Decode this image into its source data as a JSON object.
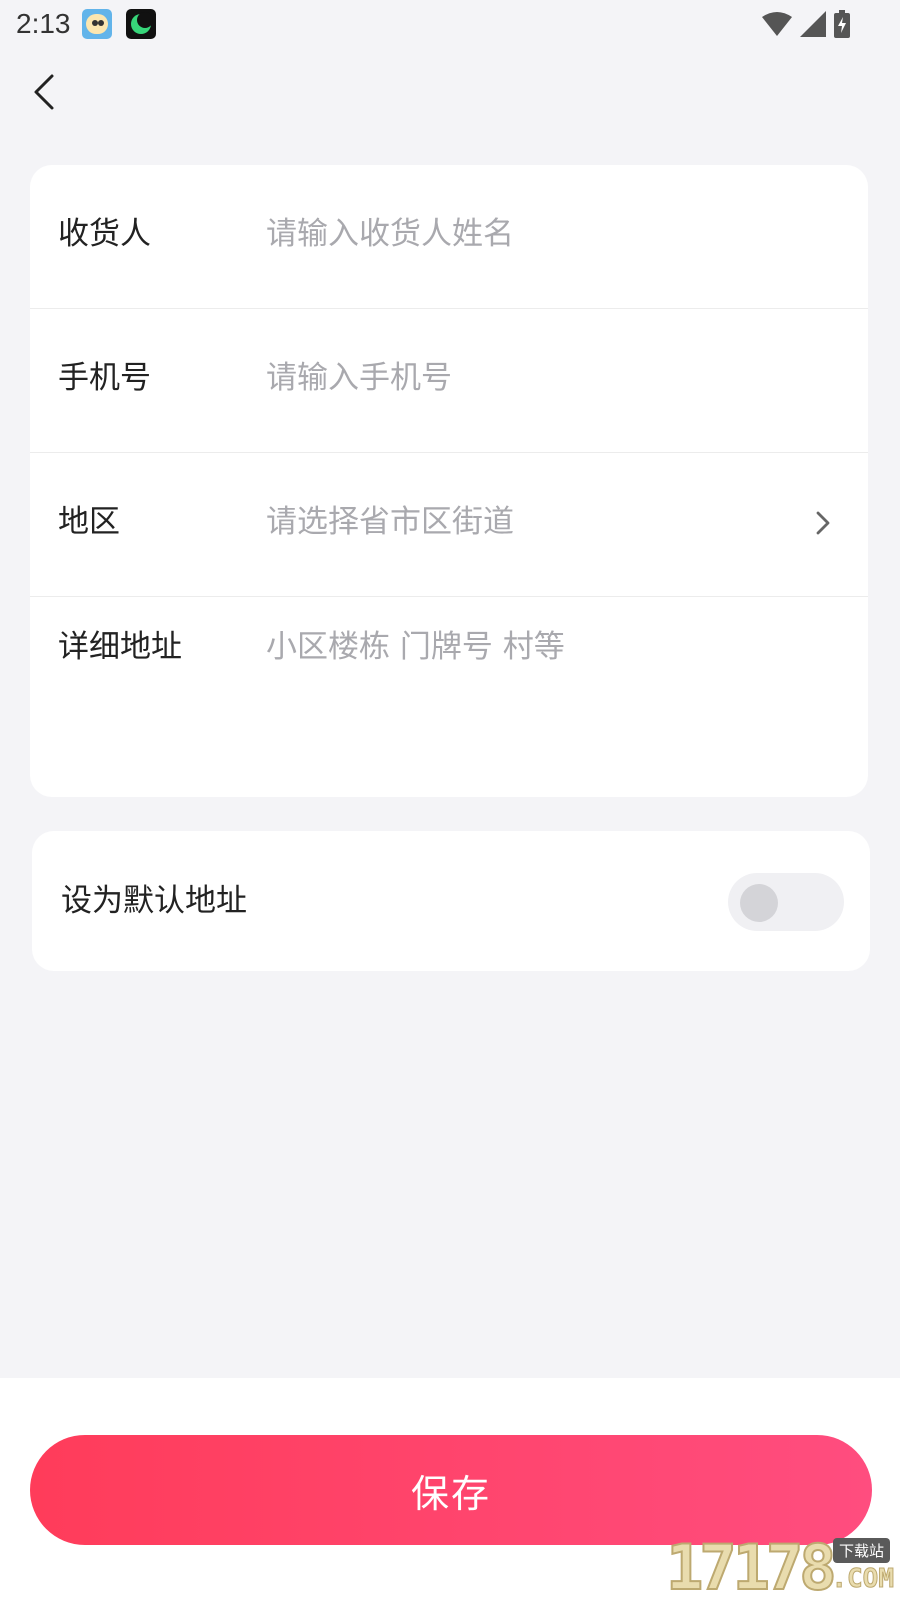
{
  "status_bar": {
    "time": "2:13",
    "icons": [
      "app-avatar-icon",
      "app-moon-icon",
      "wifi-icon",
      "signal-icon",
      "battery-icon"
    ]
  },
  "nav": {
    "back_icon": "chevron-left-icon"
  },
  "form": {
    "recipient": {
      "label": "收货人",
      "placeholder": "请输入收货人姓名"
    },
    "phone": {
      "label": "手机号",
      "placeholder": "请输入手机号"
    },
    "region": {
      "label": "地区",
      "placeholder": "请选择省市区街道",
      "icon": "chevron-right-icon"
    },
    "detail": {
      "label": "详细地址",
      "placeholder": "小区楼栋 门牌号 村等"
    }
  },
  "default_address": {
    "label": "设为默认地址",
    "enabled": false
  },
  "actions": {
    "save_label": "保存"
  },
  "colors": {
    "accent_start": "#ff3c5a",
    "accent_end": "#ff4d7f",
    "background": "#f4f4f7"
  },
  "watermark": {
    "number": "17178",
    "tag": "下载站",
    "suffix": ".COM"
  }
}
